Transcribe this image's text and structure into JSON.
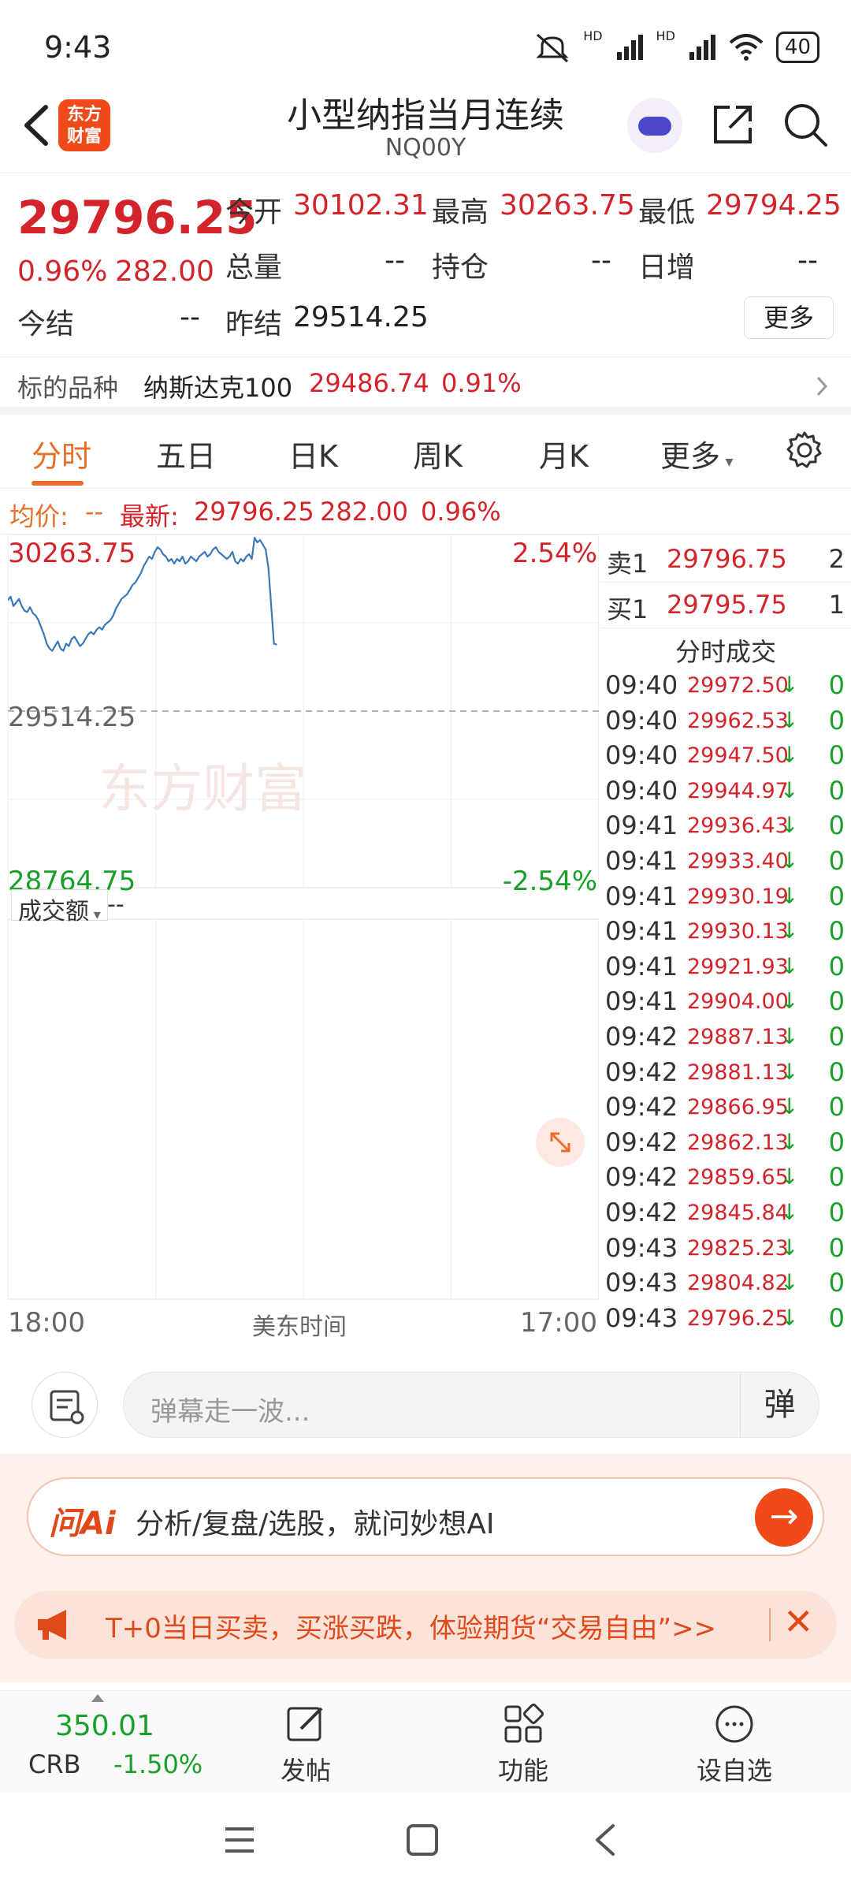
{
  "status": {
    "time": "9:43",
    "battery": "40",
    "hd1": "HD",
    "hd2": "HD"
  },
  "header": {
    "back_icon": "chevron-left-icon",
    "logo": "东方\n财富",
    "logo_line1": "东方",
    "logo_line2": "财富",
    "title": "小型纳指当月连续",
    "code": "NQ00Y"
  },
  "quote": {
    "price": "29796.25",
    "change_pct": "0.96%",
    "change": "282.00",
    "open_label": "今开",
    "open": "30102.31",
    "high_label": "最高",
    "high": "30263.75",
    "low_label": "最低",
    "low": "29794.25",
    "volume_label": "总量",
    "volume": "--",
    "position_label": "持仓",
    "position": "--",
    "daily_inc_label": "日增",
    "daily_inc": "--",
    "settle_label": "今结",
    "settle": "--",
    "prev_settle_label": "昨结",
    "prev_settle": "29514.25",
    "more_label": "更多"
  },
  "underlying": {
    "label": "标的品种",
    "name": "纳斯达克100",
    "price": "29486.74",
    "pct": "0.91%"
  },
  "tabs": [
    "分时",
    "五日",
    "日K",
    "周K",
    "月K",
    "更多"
  ],
  "info": {
    "avg_label": "均价:",
    "avg": "--",
    "latest_label": "最新:",
    "latest": "29796.25",
    "chg": "282.00",
    "pct": "0.96%"
  },
  "chart_labels": {
    "top_price": "30263.75",
    "top_pct": "2.54%",
    "mid_price": "29514.25",
    "bottom_price": "28764.75",
    "bottom_pct": "-2.54%",
    "vol_label": "成交额",
    "vol_value": "--",
    "x_start": "18:00",
    "x_mid": "美东时间",
    "x_end": "17:00",
    "watermark": "东方财富"
  },
  "chart_data": {
    "type": "line",
    "title": "",
    "ylim": [
      28764.75,
      30263.75
    ],
    "baseline": 29514.25,
    "x_session": [
      "18:00",
      "17:00"
    ],
    "xlabel": "美东时间",
    "series": [
      {
        "values": [
          29985,
          30000,
          29960,
          29975,
          29990,
          29960,
          29940,
          29935,
          29955,
          29930,
          29920,
          29900,
          29870,
          29840,
          29800,
          29780,
          29770,
          29790,
          29810,
          29780,
          29770,
          29800,
          29790,
          29820,
          29830,
          29810,
          29790,
          29800,
          29820,
          29840,
          29850,
          29840,
          29860,
          29870,
          29860,
          29880,
          29890,
          29900,
          29920,
          29950,
          29970,
          29990,
          30000,
          30010,
          30030,
          30050,
          30060,
          30080,
          30100,
          30130,
          30150,
          30170,
          30160,
          30190,
          30210,
          30200,
          30180,
          30170,
          30150,
          30160,
          30140,
          30160,
          30150,
          30170,
          30140,
          30150,
          30170,
          30160,
          30150,
          30170,
          30180,
          30190,
          30170,
          30180,
          30200,
          30210,
          30190,
          30180,
          30170,
          30160,
          30170,
          30190,
          30150,
          30140,
          30160,
          30150,
          30170,
          30180,
          30160,
          30250,
          30230,
          30240,
          30220,
          30200,
          30120,
          29960,
          29800,
          29796.25
        ]
      }
    ]
  },
  "orderbook": {
    "ask_label": "卖1",
    "ask_price": "29796.75",
    "ask_vol": "2",
    "bid_label": "买1",
    "bid_price": "29795.75",
    "bid_vol": "1",
    "trades_title": "分时成交"
  },
  "trades": [
    {
      "time": "09:40",
      "price": "29972.50",
      "vol": "0"
    },
    {
      "time": "09:40",
      "price": "29962.53",
      "vol": "0"
    },
    {
      "time": "09:40",
      "price": "29947.50",
      "vol": "0"
    },
    {
      "time": "09:40",
      "price": "29944.97",
      "vol": "0"
    },
    {
      "time": "09:41",
      "price": "29936.43",
      "vol": "0"
    },
    {
      "time": "09:41",
      "price": "29933.40",
      "vol": "0"
    },
    {
      "time": "09:41",
      "price": "29930.19",
      "vol": "0"
    },
    {
      "time": "09:41",
      "price": "29930.13",
      "vol": "0"
    },
    {
      "time": "09:41",
      "price": "29921.93",
      "vol": "0"
    },
    {
      "time": "09:41",
      "price": "29904.00",
      "vol": "0"
    },
    {
      "time": "09:42",
      "price": "29887.13",
      "vol": "0"
    },
    {
      "time": "09:42",
      "price": "29881.13",
      "vol": "0"
    },
    {
      "time": "09:42",
      "price": "29866.95",
      "vol": "0"
    },
    {
      "time": "09:42",
      "price": "29862.13",
      "vol": "0"
    },
    {
      "time": "09:42",
      "price": "29859.65",
      "vol": "0"
    },
    {
      "time": "09:42",
      "price": "29845.84",
      "vol": "0"
    },
    {
      "time": "09:43",
      "price": "29825.23",
      "vol": "0"
    },
    {
      "time": "09:43",
      "price": "29804.82",
      "vol": "0"
    },
    {
      "time": "09:43",
      "price": "29796.25",
      "vol": "0"
    }
  ],
  "comment": {
    "placeholder": "弹幕走一波...",
    "danmu_label": "弹"
  },
  "ai": {
    "badge": "问Ai",
    "text": "分析/复盘/选股，就问妙想AI"
  },
  "promo": {
    "text": "T+0当日买卖，买涨买跌，体验期货“交易自由”>>"
  },
  "bottomnav": {
    "crb_value": "350.01",
    "crb_name": "CRB",
    "crb_pct": "-1.50%",
    "post_label": "发帖",
    "func_label": "功能",
    "watch_label": "设自选"
  },
  "colors": {
    "up": "#d4242b",
    "down": "#1aa02a",
    "accent": "#e6702a",
    "line": "#3a78b8"
  }
}
